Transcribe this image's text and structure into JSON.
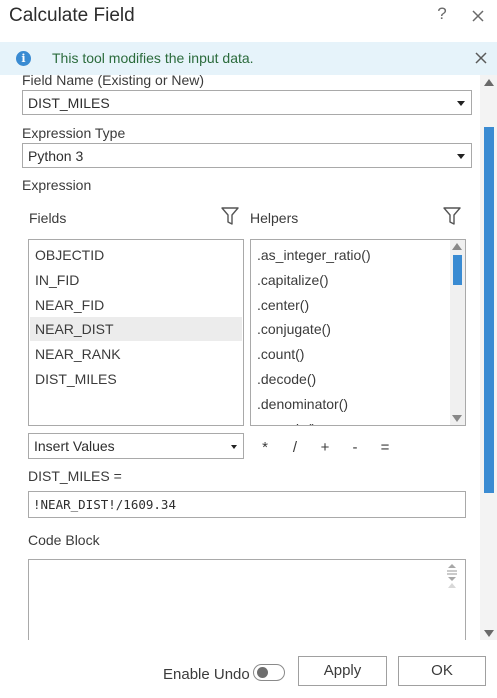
{
  "dialog": {
    "title": "Calculate Field",
    "help_label": "?"
  },
  "banner": {
    "message": "This tool modifies the input data.",
    "icon_glyph": "i",
    "accent": "#3a8bd2"
  },
  "field_name": {
    "label": "Field Name (Existing or New)",
    "value": "DIST_MILES"
  },
  "expression_type": {
    "label": "Expression Type",
    "value": "Python 3"
  },
  "expression": {
    "section_label": "Expression",
    "fields_label": "Fields",
    "helpers_label": "Helpers",
    "fields": [
      "OBJECTID",
      "IN_FID",
      "NEAR_FID",
      "NEAR_DIST",
      "NEAR_RANK",
      "DIST_MILES"
    ],
    "selected_field": "NEAR_DIST",
    "helpers": [
      ".as_integer_ratio()",
      ".capitalize()",
      ".center()",
      ".conjugate()",
      ".count()",
      ".decode()",
      ".denominator()",
      ".encode()"
    ],
    "insert_values": "Insert Values",
    "operators": [
      "*",
      "/",
      "+",
      "-",
      "="
    ],
    "target_label": "DIST_MILES =",
    "value": "!NEAR_DIST!/1609.34"
  },
  "code_block": {
    "label": "Code Block",
    "value": ""
  },
  "footer": {
    "enable_undo_label": "Enable Undo",
    "enable_undo_on": false,
    "apply_label": "Apply",
    "ok_label": "OK"
  }
}
